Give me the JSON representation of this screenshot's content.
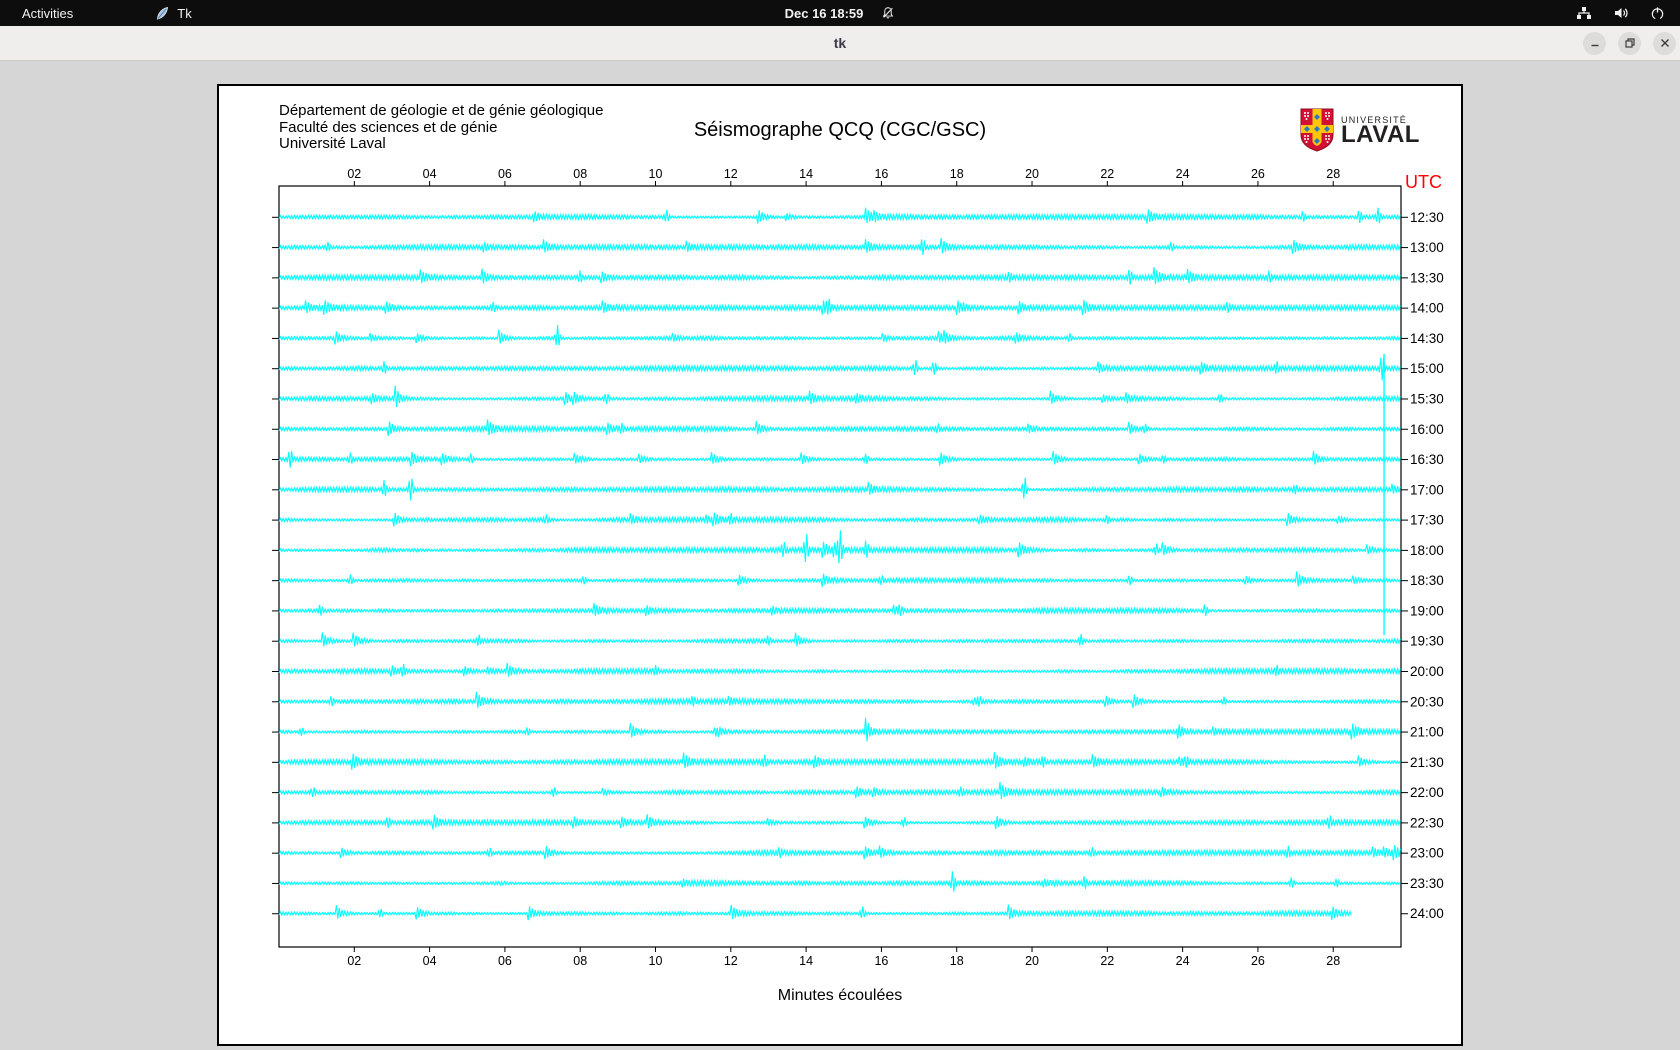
{
  "topbar": {
    "activities_label": "Activities",
    "app_name": "Tk",
    "clock": "Dec 16  18:59"
  },
  "titlebar": {
    "title": "tk"
  },
  "header": {
    "institution_lines": [
      "Département de géologie et de génie géologique",
      "Faculté des sciences et de génie",
      "Université Laval"
    ],
    "title": "Séismographe QCQ (CGC/GSC)",
    "logo": {
      "line1": "UNIVERSITÉ",
      "line2": "LAVAL"
    }
  },
  "chart_data": {
    "type": "line",
    "title": "Séismographe QCQ (CGC/GSC)",
    "xlabel": "Minutes écoulées",
    "utc_label": "UTC",
    "x_ticks": [
      "02",
      "04",
      "06",
      "08",
      "10",
      "12",
      "14",
      "16",
      "18",
      "20",
      "22",
      "24",
      "26",
      "28"
    ],
    "x_range": [
      0,
      29.8
    ],
    "minutes_per_line": 30,
    "trace_color": "#00ffff",
    "frame_color": "#000000",
    "utc_color": "#ff0000",
    "traces": [
      {
        "label": "12:30",
        "spikes": [
          [
            10.3,
            6
          ],
          [
            27.2,
            5
          ],
          [
            28.7,
            6
          ],
          [
            29.2,
            8
          ]
        ]
      },
      {
        "label": "13:00",
        "spikes": [
          [
            1.3,
            4
          ],
          [
            17.1,
            8
          ],
          [
            23.7,
            4
          ]
        ]
      },
      {
        "label": "13:30",
        "spikes": [
          [
            8.0,
            5
          ],
          [
            19.4,
            4
          ],
          [
            22.6,
            7
          ],
          [
            26.3,
            5
          ]
        ]
      },
      {
        "label": "14:00",
        "spikes": [
          [
            5.7,
            4
          ],
          [
            14.6,
            5
          ],
          [
            25.2,
            4
          ]
        ]
      },
      {
        "label": "14:30",
        "spikes": [
          [
            7.4,
            12
          ],
          [
            21.0,
            4
          ]
        ]
      },
      {
        "label": "15:00",
        "spikes": [
          [
            2.8,
            6
          ],
          [
            16.9,
            8
          ],
          [
            17.4,
            7
          ],
          [
            26.5,
            5
          ],
          [
            29.3,
            14
          ]
        ]
      },
      {
        "label": "15:30",
        "spikes": [
          [
            3.1,
            4
          ],
          [
            8.7,
            5
          ],
          [
            25.0,
            4
          ]
        ]
      },
      {
        "label": "16:00",
        "spikes": [
          [
            9.1,
            4
          ],
          [
            17.5,
            4
          ],
          [
            23.0,
            4
          ]
        ]
      },
      {
        "label": "16:30",
        "spikes": [
          [
            0.3,
            9
          ],
          [
            1.9,
            5
          ],
          [
            5.1,
            5
          ],
          [
            15.6,
            5
          ],
          [
            23.5,
            4
          ]
        ]
      },
      {
        "label": "17:00",
        "spikes": [
          [
            2.8,
            8
          ],
          [
            3.5,
            13
          ],
          [
            19.8,
            12
          ],
          [
            27.0,
            4
          ]
        ]
      },
      {
        "label": "17:30",
        "spikes": [
          [
            7.1,
            4
          ],
          [
            12.0,
            4
          ],
          [
            22.0,
            4
          ]
        ]
      },
      {
        "label": "18:00",
        "spikes": [
          [
            13.4,
            7
          ],
          [
            14.0,
            15
          ],
          [
            14.9,
            16
          ],
          [
            15.6,
            8
          ],
          [
            23.3,
            6
          ]
        ]
      },
      {
        "label": "18:30",
        "spikes": [
          [
            1.9,
            5
          ],
          [
            8.1,
            4
          ],
          [
            16.0,
            4
          ],
          [
            22.6,
            5
          ]
        ]
      },
      {
        "label": "19:00",
        "spikes": [
          [
            1.1,
            5
          ],
          [
            16.5,
            4
          ],
          [
            24.6,
            6
          ]
        ]
      },
      {
        "label": "19:30",
        "spikes": [
          [
            5.3,
            5
          ],
          [
            13.0,
            4
          ],
          [
            21.3,
            6
          ]
        ]
      },
      {
        "label": "20:00",
        "spikes": [
          [
            3.3,
            5
          ],
          [
            10.0,
            4
          ],
          [
            26.5,
            4
          ]
        ]
      },
      {
        "label": "20:30",
        "spikes": [
          [
            1.4,
            5
          ],
          [
            11.0,
            4
          ],
          [
            18.6,
            4
          ],
          [
            25.1,
            4
          ]
        ]
      },
      {
        "label": "21:00",
        "spikes": [
          [
            0.6,
            4
          ],
          [
            6.6,
            4
          ],
          [
            11.6,
            5
          ],
          [
            15.6,
            5
          ]
        ]
      },
      {
        "label": "21:30",
        "spikes": [
          [
            12.9,
            5
          ],
          [
            20.3,
            5
          ],
          [
            24.1,
            4
          ]
        ]
      },
      {
        "label": "22:00",
        "spikes": [
          [
            0.9,
            4
          ],
          [
            7.3,
            5
          ],
          [
            18.1,
            4
          ]
        ]
      },
      {
        "label": "22:30",
        "spikes": [
          [
            2.9,
            5
          ],
          [
            16.6,
            5
          ],
          [
            27.9,
            6
          ]
        ]
      },
      {
        "label": "23:00",
        "spikes": [
          [
            5.6,
            4
          ],
          [
            13.3,
            4
          ],
          [
            21.6,
            4
          ],
          [
            26.8,
            5
          ]
        ]
      },
      {
        "label": "23:30",
        "spikes": [
          [
            17.9,
            11
          ],
          [
            21.4,
            6
          ],
          [
            26.9,
            5
          ],
          [
            28.1,
            4
          ]
        ]
      },
      {
        "label": "24:00",
        "spikes": [
          [
            2.7,
            4
          ],
          [
            15.5,
            6
          ]
        ],
        "end_minute": 28.5
      }
    ],
    "event_line": {
      "minute": 29.35,
      "from_trace": 5,
      "to_trace": 14,
      "top_offset": -15,
      "bottom_offset": -6
    }
  }
}
